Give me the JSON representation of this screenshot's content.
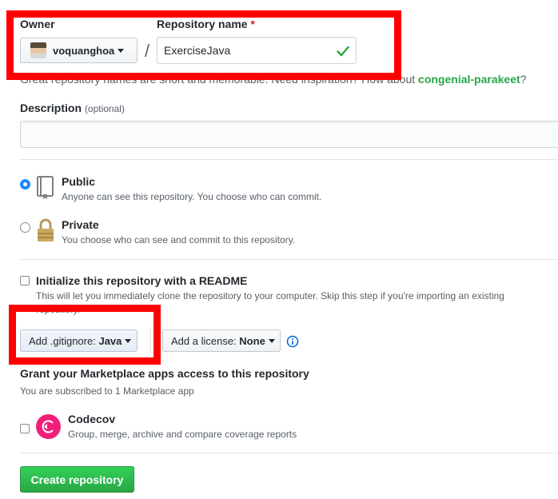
{
  "owner": {
    "label": "Owner",
    "value": "voquanghoa"
  },
  "repo_name": {
    "label": "Repository name",
    "required_mark": "*",
    "value": "ExerciseJava",
    "separator": "/"
  },
  "hint": {
    "text": "Great repository names are short and memorable. Need inspiration? How about",
    "suggestion": "congenial-parakeet",
    "end": "?"
  },
  "description": {
    "label": "Description",
    "optional": "(optional)",
    "value": ""
  },
  "visibility": {
    "public": {
      "title": "Public",
      "desc": "Anyone can see this repository. You choose who can commit.",
      "selected": true
    },
    "private": {
      "title": "Private",
      "desc": "You choose who can see and commit to this repository.",
      "selected": false
    }
  },
  "readme": {
    "title": "Initialize this repository with a README",
    "desc": "This will let you immediately clone the repository to your computer. Skip this step if you're importing an existing",
    "desc_cont": "repository.",
    "checked": false
  },
  "gitignore": {
    "prefix": "Add .gitignore:",
    "value": "Java"
  },
  "license": {
    "prefix": "Add a license:",
    "value": "None"
  },
  "marketplace": {
    "title": "Grant your Marketplace apps access to this repository",
    "subtitle": "You are subscribed to 1 Marketplace app",
    "app": {
      "name": "Codecov",
      "desc": "Group, merge, archive and compare coverage reports"
    }
  },
  "create_button": "Create repository",
  "colors": {
    "accent_blue": "#2188ff",
    "success_green": "#28a745",
    "highlight_red": "#ff0000",
    "codecov_pink": "#f01f7a"
  },
  "icons": [
    "check-icon",
    "repo-icon",
    "lock-icon",
    "info-icon",
    "codecov-logo"
  ]
}
